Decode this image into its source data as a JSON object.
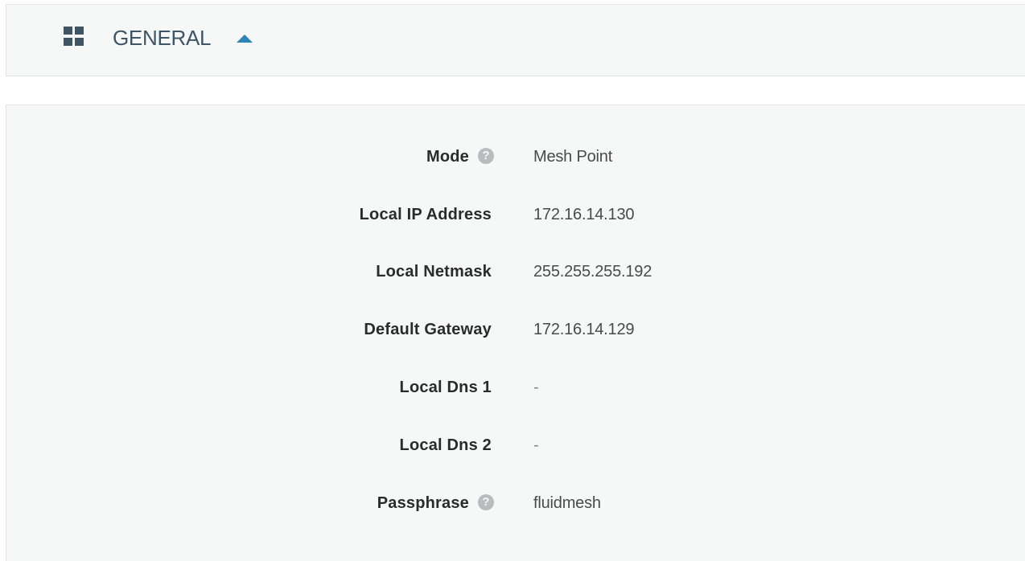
{
  "header": {
    "title": "GENERAL",
    "icon": "grid-icon",
    "toggle_icon": "caret-up-icon",
    "accent_color": "#2e83b8"
  },
  "general": {
    "rows": [
      {
        "label": "Mode",
        "value": "Mesh Point",
        "has_help": true
      },
      {
        "label": "Local IP Address",
        "value": "172.16.14.130",
        "has_help": false
      },
      {
        "label": "Local Netmask",
        "value": "255.255.255.192",
        "has_help": false
      },
      {
        "label": "Default Gateway",
        "value": "172.16.14.129",
        "has_help": false
      },
      {
        "label": "Local Dns 1",
        "value": "-",
        "has_help": false
      },
      {
        "label": "Local Dns 2",
        "value": "-",
        "has_help": false
      },
      {
        "label": "Passphrase",
        "value": "fluidmesh",
        "has_help": true
      }
    ],
    "help_icon_glyph": "?"
  }
}
